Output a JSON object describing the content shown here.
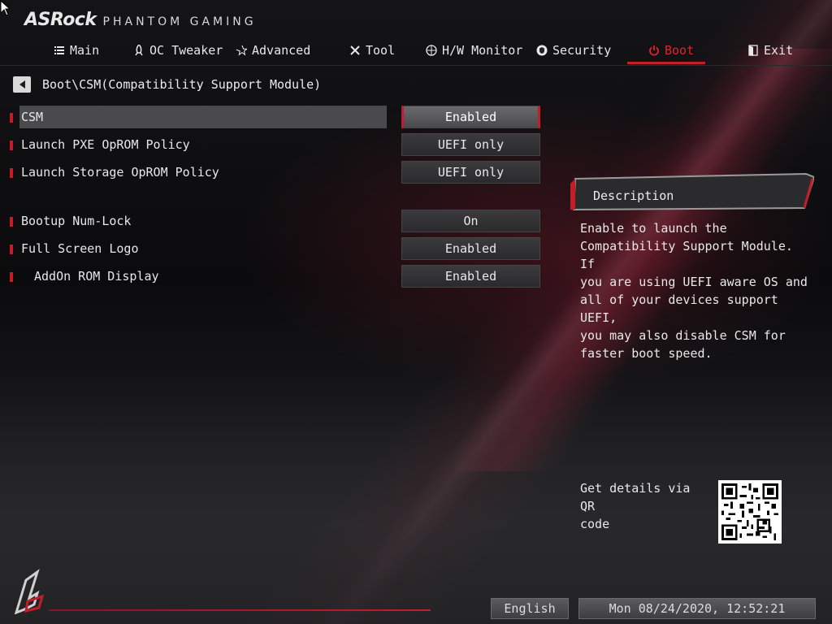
{
  "brand": {
    "name": "ASRock",
    "subtitle": "PHANTOM GAMING"
  },
  "nav": {
    "items": [
      {
        "label": "Main",
        "icon": "list-icon"
      },
      {
        "label": "OC Tweaker",
        "icon": "rocket-icon"
      },
      {
        "label": "Advanced",
        "icon": "star-icon"
      },
      {
        "label": "Tool",
        "icon": "tools-icon"
      },
      {
        "label": "H/W Monitor",
        "icon": "crosshair-icon"
      },
      {
        "label": "Security",
        "icon": "shield-icon"
      },
      {
        "label": "Boot",
        "icon": "power-icon",
        "active": true
      },
      {
        "label": "Exit",
        "icon": "exit-icon"
      }
    ],
    "accent_color": "#c21d28"
  },
  "breadcrumb": {
    "path": "Boot\\CSM(Compatibility Support Module)"
  },
  "settings": [
    {
      "label": "CSM",
      "value": "Enabled",
      "selected": true
    },
    {
      "label": "Launch PXE OpROM Policy",
      "value": "UEFI only"
    },
    {
      "label": "Launch Storage OpROM Policy",
      "value": "UEFI only"
    },
    {
      "label": "Bootup Num-Lock",
      "value": "On"
    },
    {
      "label": "Full Screen Logo",
      "value": "Enabled"
    },
    {
      "label": "AddOn ROM Display",
      "value": "Enabled",
      "indent": true
    }
  ],
  "description": {
    "title": "Description",
    "text": "Enable to launch the\nCompatibility Support Module. If\nyou are using UEFI aware OS and\nall of your devices support UEFI,\nyou may also disable CSM for\nfaster boot speed."
  },
  "qr": {
    "text": "Get details via QR\ncode"
  },
  "footer": {
    "language": "English",
    "datetime": "Mon 08/24/2020, 12:52:21"
  }
}
